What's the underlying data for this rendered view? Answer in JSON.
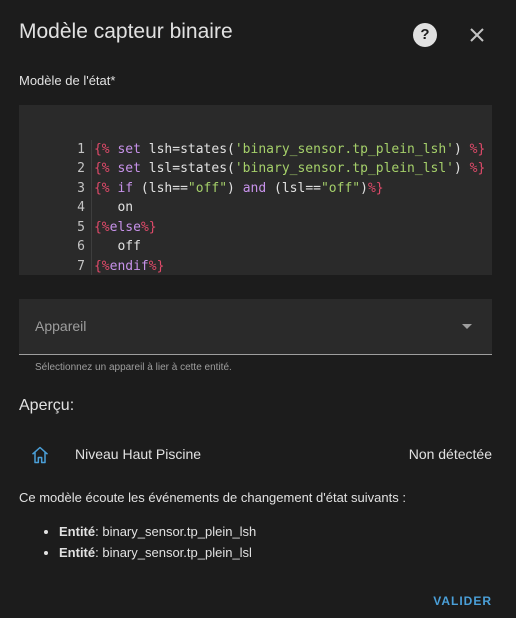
{
  "dialog": {
    "title": "Modèle capteur binaire",
    "help_icon": "question-circle-icon",
    "help_glyph": "?",
    "close_icon": "close-icon"
  },
  "template_field": {
    "label": "Modèle de l'état*",
    "line_numbers": [
      "1",
      "2",
      "3",
      "4",
      "5",
      "6",
      "7"
    ]
  },
  "code": {
    "l1": {
      "d1": "{%",
      "kw": " set",
      "rest": " lsh=states(",
      "str": "'binary_sensor.tp_plein_lsh'",
      "end": ") ",
      "d2": "%}"
    },
    "l2": {
      "d1": "{%",
      "kw": " set",
      "rest": " lsl=states(",
      "str": "'binary_sensor.tp_plein_lsl'",
      "end": ") ",
      "d2": "%}"
    },
    "l3": {
      "d1": "{%",
      "kw": " if",
      "a": " (lsh==",
      "s1": "\"off\"",
      "b": ") ",
      "and": "and",
      "c": " (lsl==",
      "s2": "\"off\"",
      "e": ")",
      "d2": "%}"
    },
    "l4": "   on",
    "l5": {
      "d1": "{%",
      "kw": "else",
      "d2": "%}"
    },
    "l6": "   off",
    "l7": {
      "d1": "{%",
      "kw": "endif",
      "d2": "%}"
    }
  },
  "device": {
    "label": "Appareil",
    "helper": "Sélectionnez un appareil à lier à cette entité."
  },
  "preview": {
    "title": "Aperçu:",
    "entity_icon": "home-icon",
    "entity_name": "Niveau Haut Piscine",
    "entity_state": "Non détectée",
    "listen_text": "Ce modèle écoute les événements de changement d'état suivants :",
    "entities": [
      {
        "prefix": "Entité",
        "value": ": binary_sensor.tp_plein_lsh"
      },
      {
        "prefix": "Entité",
        "value": ": binary_sensor.tp_plein_lsl"
      }
    ]
  },
  "actions": {
    "submit_label": "VALIDER"
  },
  "colors": {
    "background": "#1c1c1c",
    "editor_bg": "#2a2a2a",
    "accent": "#4a9fd8",
    "template_delimiter": "#e04a6a",
    "keyword": "#c792ea",
    "string": "#a5d06a"
  }
}
